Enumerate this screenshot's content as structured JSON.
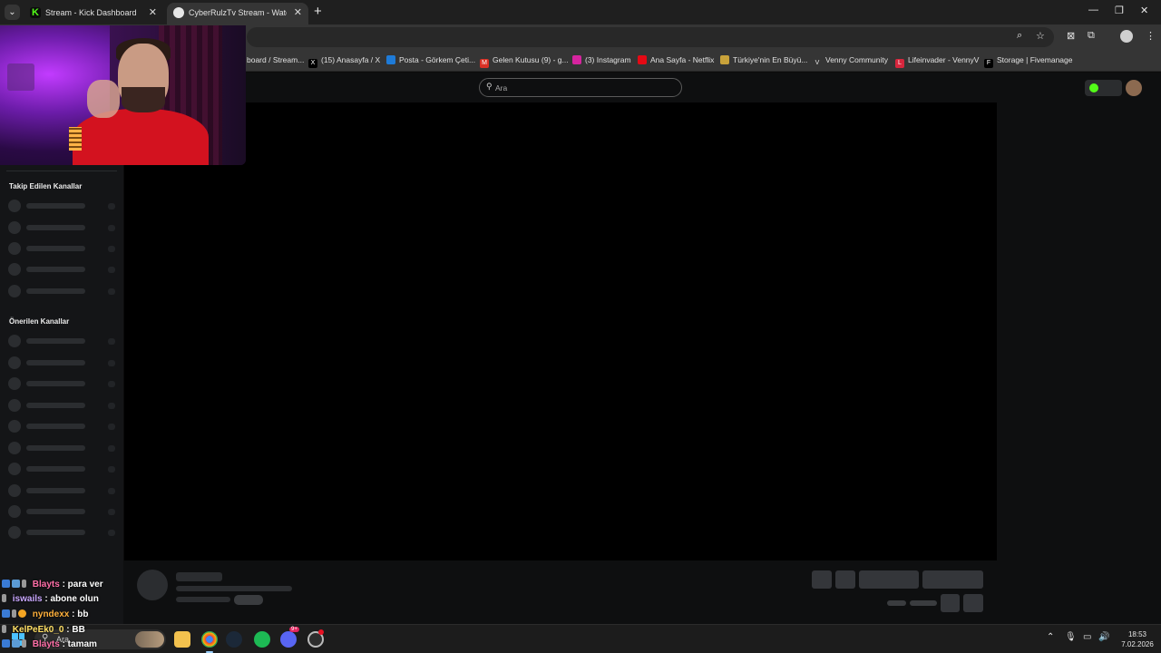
{
  "browser": {
    "tabs": [
      {
        "title": "Stream - Kick Dashboard",
        "active": false
      },
      {
        "title": "CyberRulzTv Stream - Watch Li",
        "active": true
      }
    ],
    "bookmarks": [
      {
        "label": "board / Stream..."
      },
      {
        "label": "(15) Anasayfa / X"
      },
      {
        "label": "Posta - Görkem Çeti..."
      },
      {
        "label": "Gelen Kutusu (9) - g..."
      },
      {
        "label": "(3) Instagram"
      },
      {
        "label": "Ana Sayfa - Netflix"
      },
      {
        "label": "Türkiye'nin En Büyü..."
      },
      {
        "label": "Venny Community"
      },
      {
        "label": "Lifeinvader - VennyV"
      },
      {
        "label": "Storage | Fivemanage"
      }
    ]
  },
  "site": {
    "search_placeholder": "Ara",
    "accent_color": "#53fc18"
  },
  "sidebar": {
    "followed_title": "Takip Edilen Kanallar",
    "recommended_title": "Önerilen Kanallar"
  },
  "chat": [
    {
      "user": "Blayts",
      "message": ": para ver",
      "color": "#ff6fa8"
    },
    {
      "user": "iswails",
      "message": ": abone olun",
      "color": "#c9a7ff"
    },
    {
      "user": "nyndexx",
      "message": ": bb",
      "color": "#ffb03b"
    },
    {
      "user": "KelPeEk0_0",
      "message": ": BB",
      "color": "#ffe066"
    },
    {
      "user": "Blayts",
      "message": ": tamam",
      "color": "#ff6fa8"
    }
  ],
  "taskbar": {
    "search_placeholder": "Ara",
    "time": "18:53",
    "date": "7.02.2026",
    "discord_badge": "9+"
  }
}
